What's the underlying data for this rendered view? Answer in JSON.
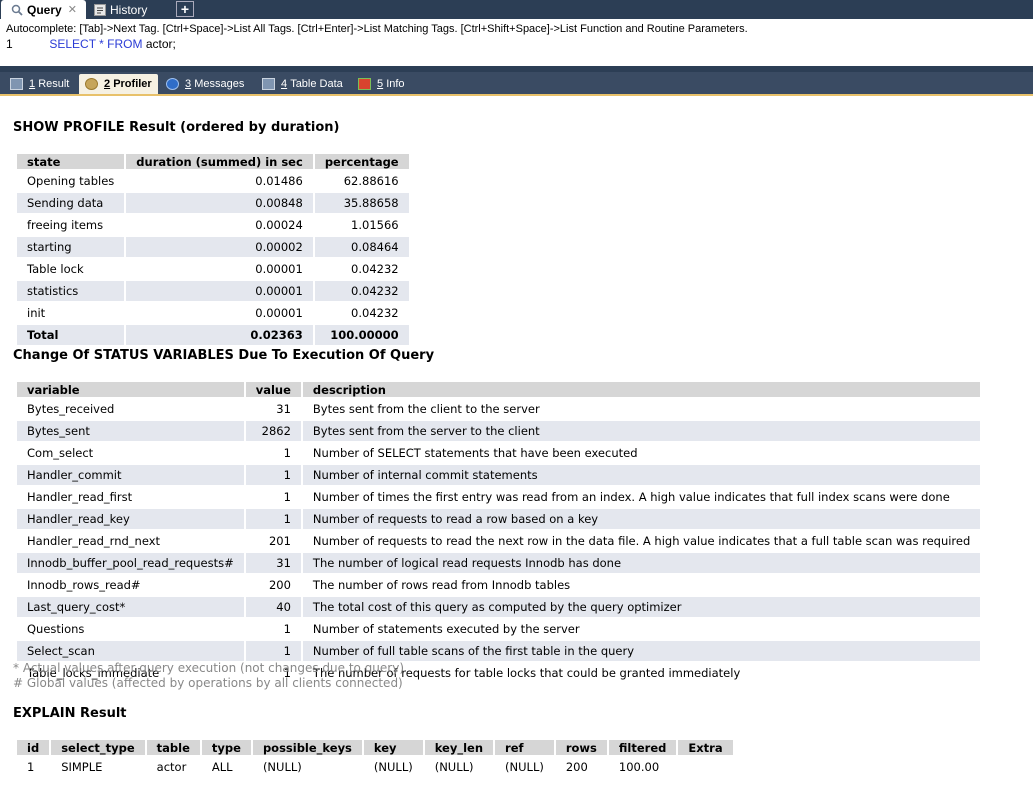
{
  "tabs": {
    "query_label": "Query",
    "history_label": "History",
    "new_tab_label": "+"
  },
  "editor": {
    "autocomplete_hint": "Autocomplete: [Tab]->Next Tag. [Ctrl+Space]->List All Tags. [Ctrl+Enter]->List Matching Tags. [Ctrl+Shift+Space]->List Function and Routine Parameters.",
    "line_number": "1",
    "kw_select": "SELECT",
    "star": "*",
    "kw_from": "FROM",
    "table": "actor;"
  },
  "result_tabs": [
    {
      "num": "1",
      "label": "Result"
    },
    {
      "num": "2",
      "label": "Profiler"
    },
    {
      "num": "3",
      "label": "Messages"
    },
    {
      "num": "4",
      "label": "Table Data"
    },
    {
      "num": "5",
      "label": "Info"
    }
  ],
  "profile": {
    "title": "SHOW PROFILE Result (ordered by duration)",
    "columns": [
      "state",
      "duration (summed) in sec",
      "percentage"
    ],
    "rows": [
      [
        "Opening tables",
        "0.01486",
        "62.88616"
      ],
      [
        "Sending data",
        "0.00848",
        "35.88658"
      ],
      [
        "freeing items",
        "0.00024",
        "1.01566"
      ],
      [
        "starting",
        "0.00002",
        "0.08464"
      ],
      [
        "Table lock",
        "0.00001",
        "0.04232"
      ],
      [
        "statistics",
        "0.00001",
        "0.04232"
      ],
      [
        "init",
        "0.00001",
        "0.04232"
      ]
    ],
    "total": [
      "Total",
      "0.02363",
      "100.00000"
    ]
  },
  "status": {
    "title": "Change Of STATUS VARIABLES Due To Execution Of Query",
    "columns": [
      "variable",
      "value",
      "description"
    ],
    "rows": [
      [
        "Bytes_received",
        "31",
        "Bytes sent from the client to the server"
      ],
      [
        "Bytes_sent",
        "2862",
        "Bytes sent from the server to the client"
      ],
      [
        "Com_select",
        "1",
        "Number of SELECT statements that have been executed"
      ],
      [
        "Handler_commit",
        "1",
        "Number of internal commit statements"
      ],
      [
        "Handler_read_first",
        "1",
        "Number of times the first entry was read from an index. A high value indicates that full index scans were done"
      ],
      [
        "Handler_read_key",
        "1",
        "Number of requests to read a row based on a key"
      ],
      [
        "Handler_read_rnd_next",
        "201",
        "Number of requests to read the next row in the data file. A high value indicates that a full table scan was required"
      ],
      [
        "Innodb_buffer_pool_read_requests#",
        "31",
        "The number of logical read requests Innodb has done"
      ],
      [
        "Innodb_rows_read#",
        "200",
        "The number of rows read from Innodb tables"
      ],
      [
        "Last_query_cost*",
        "40",
        "The total cost of this query as computed by the query optimizer"
      ],
      [
        "Questions",
        "1",
        "Number of statements executed by the server"
      ],
      [
        "Select_scan",
        "1",
        "Number of full table scans of the first table in the query"
      ],
      [
        "Table_locks_immediate",
        "1",
        "The number of requests for table locks that could be granted immediately"
      ]
    ],
    "note1": "* Actual values after query execution (not changes due to query)",
    "note2": "# Global values (affected by operations by all clients connected)"
  },
  "explain": {
    "title": "EXPLAIN Result",
    "columns": [
      "id",
      "select_type",
      "table",
      "type",
      "possible_keys",
      "key",
      "key_len",
      "ref",
      "rows",
      "filtered",
      "Extra"
    ],
    "rows": [
      [
        "1",
        "SIMPLE",
        "actor",
        "ALL",
        "(NULL)",
        "(NULL)",
        "(NULL)",
        "(NULL)",
        "200",
        "100.00",
        ""
      ]
    ]
  }
}
